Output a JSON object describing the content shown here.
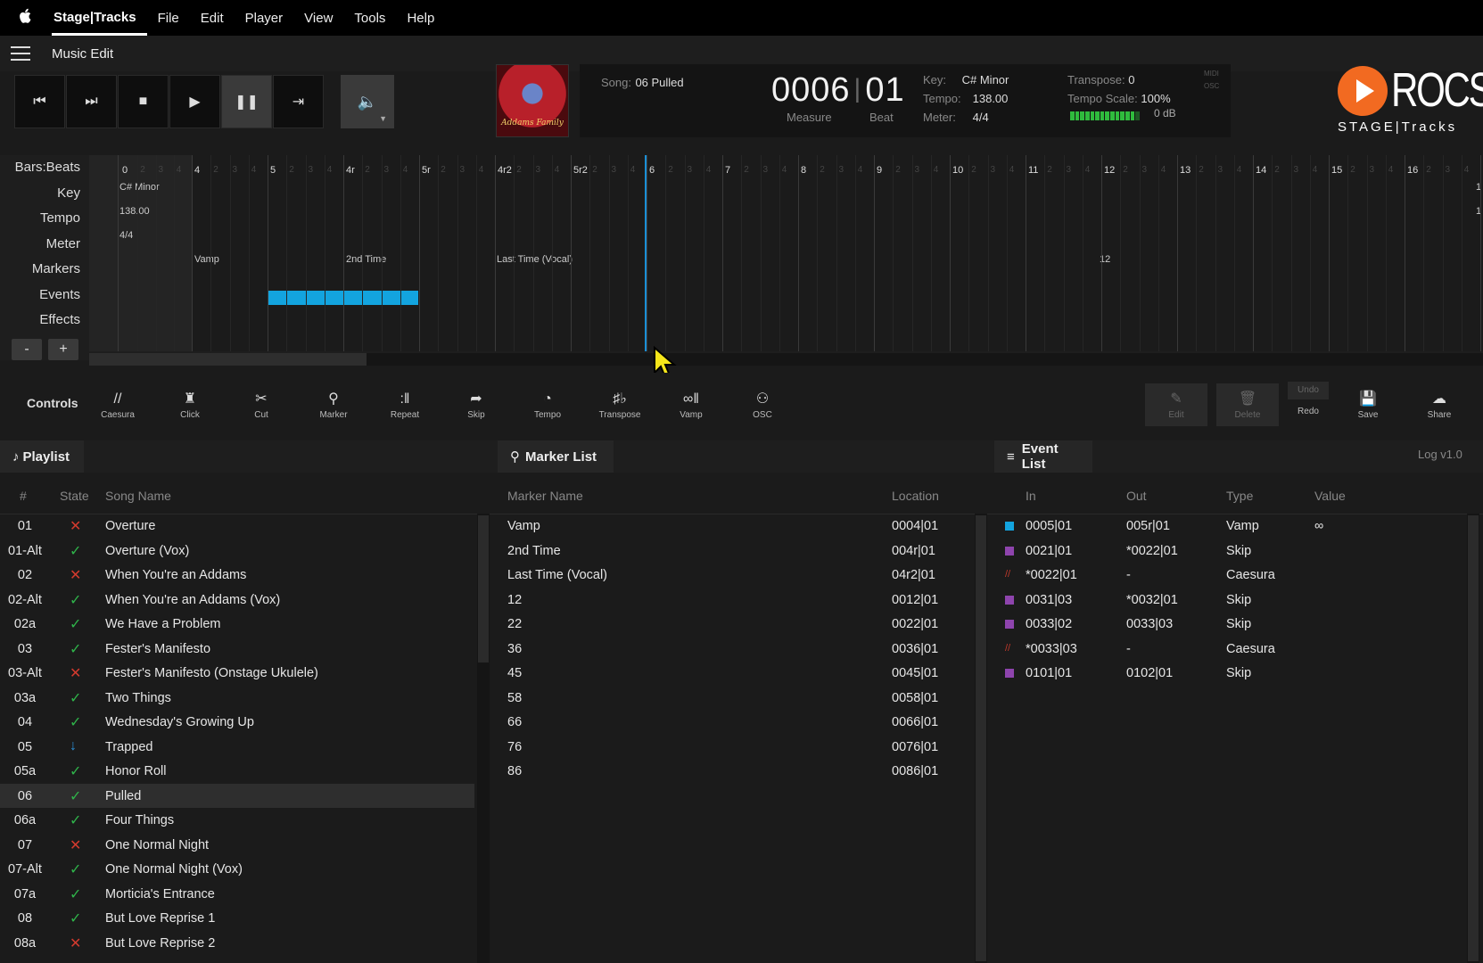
{
  "menubar": {
    "apple": "",
    "app_name": "Stage|Tracks",
    "menus": [
      "File",
      "Edit",
      "Player",
      "View",
      "Tools",
      "Help"
    ]
  },
  "window": {
    "title": "Music Edit"
  },
  "transport": {
    "buttons": [
      {
        "name": "skip-to-start",
        "icon": "⏮"
      },
      {
        "name": "next-song",
        "icon": "⏭"
      },
      {
        "name": "stop",
        "icon": "■"
      },
      {
        "name": "play",
        "icon": "▶"
      },
      {
        "name": "pause",
        "icon": "❚❚"
      },
      {
        "name": "skip-to-end",
        "icon": "⇥"
      }
    ],
    "volume_icon": "🔈"
  },
  "album_cover": {
    "text": "Addams Family"
  },
  "song_info": {
    "song_label": "Song:",
    "song_value": "06 Pulled",
    "measure": "0006",
    "beat": "01",
    "measure_label": "Measure",
    "beat_label": "Beat",
    "key_label": "Key:",
    "key_value": "C# Minor",
    "tempo_label": "Tempo:",
    "tempo_value": "138.00",
    "meter_label": "Meter:",
    "meter_value": "4/4",
    "transpose_label": "Transpose:",
    "transpose_value": "0",
    "tempo_scale_label": "Tempo Scale:",
    "tempo_scale_value": "100%",
    "db_value": "0 dB",
    "level_fraction": 0.9,
    "midi_label": "MIDI",
    "osc_label": "OSC"
  },
  "logo": {
    "name": "ROCS",
    "subtitle": "STAGE|Tracks",
    "brand_color": "#f26a21"
  },
  "timeline": {
    "row_labels": [
      "Bars:Beats",
      "Key",
      "Tempo",
      "Meter",
      "Markers",
      "Events",
      "Effects"
    ],
    "key_value": "C# Minor",
    "tempo_value": "138.00",
    "meter_value": "4/4",
    "bar_labels": [
      "0",
      "4",
      "5",
      "4r",
      "5r",
      "4r2",
      "5r2",
      "6",
      "7",
      "8",
      "9",
      "10",
      "11",
      "12",
      "13",
      "14",
      "15",
      "16",
      "1"
    ],
    "beat_labels": [
      "2",
      "3",
      "4"
    ],
    "markers": [
      "Vamp",
      "2nd Time",
      "Last Time (Vocal)",
      "12"
    ],
    "right_edge_labels": [
      "1",
      "1"
    ],
    "playhead_color": "#1a8fd6",
    "event_color": "#13a4df",
    "zoom_out": "-",
    "zoom_in": "+"
  },
  "controls": {
    "label": "Controls",
    "tools": [
      {
        "name": "caesura",
        "label": "Caesura",
        "icon": "//"
      },
      {
        "name": "click",
        "label": "Click",
        "icon": "♜"
      },
      {
        "name": "cut",
        "label": "Cut",
        "icon": "✂"
      },
      {
        "name": "marker",
        "label": "Marker",
        "icon": "⚲"
      },
      {
        "name": "repeat",
        "label": "Repeat",
        "icon": ":‖"
      },
      {
        "name": "skip",
        "label": "Skip",
        "icon": "➦"
      },
      {
        "name": "tempo",
        "label": "Tempo",
        "icon": "◔"
      },
      {
        "name": "transpose",
        "label": "Transpose",
        "icon": "♯♭"
      },
      {
        "name": "vamp",
        "label": "Vamp",
        "icon": "∞‖"
      },
      {
        "name": "osc",
        "label": "OSC",
        "icon": "⚇"
      }
    ],
    "edit_label": "Edit",
    "delete_label": "Delete",
    "undo_label": "Undo",
    "redo_label": "Redo",
    "save_label": "Save",
    "share_label": "Share"
  },
  "playlist": {
    "title": "Playlist",
    "columns": [
      "#",
      "State",
      "Song Name"
    ],
    "rows": [
      {
        "num": "01",
        "state": "x",
        "name": "Overture"
      },
      {
        "num": "01-Alt",
        "state": "ok",
        "name": "Overture (Vox)"
      },
      {
        "num": "02",
        "state": "x",
        "name": "When You're an Addams"
      },
      {
        "num": "02-Alt",
        "state": "ok",
        "name": "When You're an Addams (Vox)"
      },
      {
        "num": "02a",
        "state": "ok",
        "name": "We Have a Problem"
      },
      {
        "num": "03",
        "state": "ok",
        "name": "Fester's Manifesto"
      },
      {
        "num": "03-Alt",
        "state": "x",
        "name": "Fester's Manifesto (Onstage Ukulele)"
      },
      {
        "num": "03a",
        "state": "ok",
        "name": "Two Things"
      },
      {
        "num": "04",
        "state": "ok",
        "name": "Wednesday's Growing Up"
      },
      {
        "num": "05",
        "state": "down",
        "name": "Trapped"
      },
      {
        "num": "05a",
        "state": "ok",
        "name": "Honor Roll"
      },
      {
        "num": "06",
        "state": "ok",
        "name": "Pulled"
      },
      {
        "num": "06a",
        "state": "ok",
        "name": "Four Things"
      },
      {
        "num": "07",
        "state": "x",
        "name": "One Normal Night"
      },
      {
        "num": "07-Alt",
        "state": "ok",
        "name": "One Normal Night (Vox)"
      },
      {
        "num": "07a",
        "state": "ok",
        "name": "Morticia's Entrance"
      },
      {
        "num": "08",
        "state": "ok",
        "name": "But Love Reprise 1"
      },
      {
        "num": "08a",
        "state": "x",
        "name": "But Love Reprise 2"
      }
    ],
    "selected_index": 11
  },
  "marker_list": {
    "title": "Marker List",
    "columns": [
      "Marker Name",
      "Location"
    ],
    "rows": [
      {
        "name": "Vamp",
        "location": "0004|01"
      },
      {
        "name": "2nd Time",
        "location": "004r|01"
      },
      {
        "name": "Last Time (Vocal)",
        "location": "04r2|01"
      },
      {
        "name": "12",
        "location": "0012|01"
      },
      {
        "name": "22",
        "location": "0022|01"
      },
      {
        "name": "36",
        "location": "0036|01"
      },
      {
        "name": "45",
        "location": "0045|01"
      },
      {
        "name": "58",
        "location": "0058|01"
      },
      {
        "name": "66",
        "location": "0066|01"
      },
      {
        "name": "76",
        "location": "0076|01"
      },
      {
        "name": "86",
        "location": "0086|01"
      }
    ]
  },
  "event_list": {
    "title": "Event List",
    "log": "Log v1.0",
    "columns": [
      "In",
      "Out",
      "Type",
      "Value"
    ],
    "rows": [
      {
        "swatch": "#13a4df",
        "in": "0005|01",
        "out": "005r|01",
        "type": "Vamp",
        "value": "∞"
      },
      {
        "swatch": "#8e44ad",
        "in": "0021|01",
        "out": "*0022|01",
        "type": "Skip",
        "value": ""
      },
      {
        "swatch": "caesura",
        "in": "*0022|01",
        "out": "-",
        "type": "Caesura",
        "value": ""
      },
      {
        "swatch": "#8e44ad",
        "in": "0031|03",
        "out": "*0032|01",
        "type": "Skip",
        "value": ""
      },
      {
        "swatch": "#8e44ad",
        "in": "0033|02",
        "out": "0033|03",
        "type": "Skip",
        "value": ""
      },
      {
        "swatch": "caesura",
        "in": "*0033|03",
        "out": "-",
        "type": "Caesura",
        "value": ""
      },
      {
        "swatch": "#8e44ad",
        "in": "0101|01",
        "out": "0102|01",
        "type": "Skip",
        "value": ""
      }
    ]
  }
}
